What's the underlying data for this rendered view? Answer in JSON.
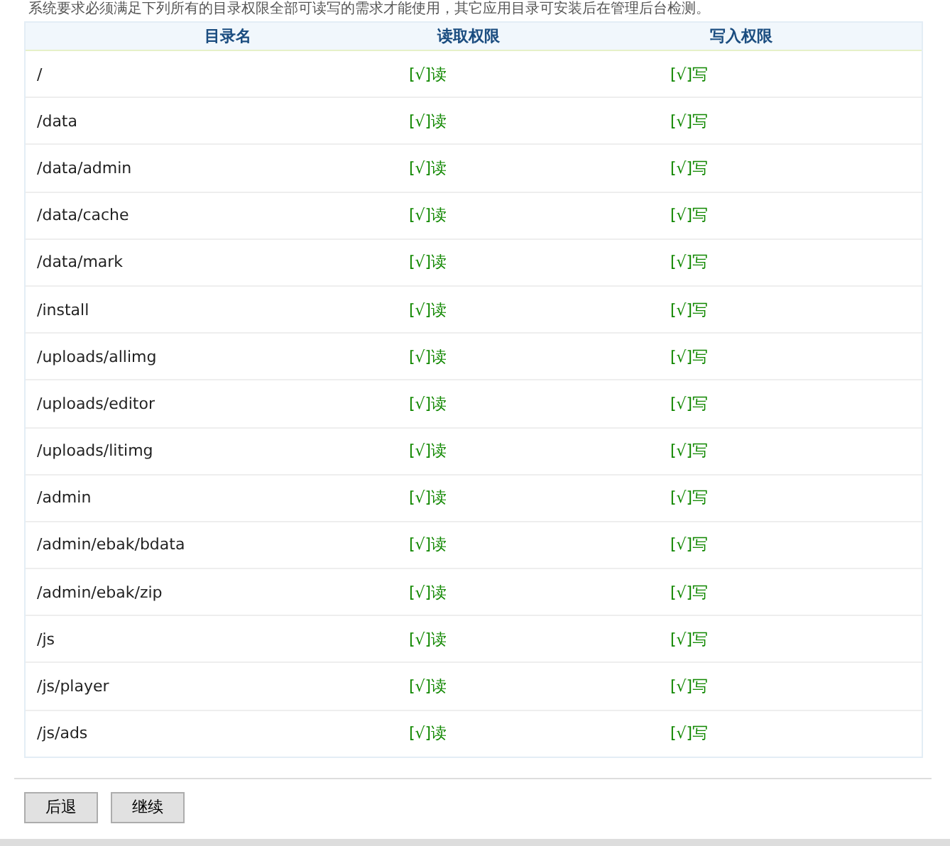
{
  "intro": "系统要求必须满足下列所有的目录权限全部可读写的需求才能使用，其它应用目录可安装后在管理后台检测。",
  "table": {
    "columns": [
      "目录名",
      "读取权限",
      "写入权限"
    ],
    "rows": [
      {
        "dir": "/",
        "read": "[√]读",
        "write": "[√]写"
      },
      {
        "dir": "/data",
        "read": "[√]读",
        "write": "[√]写"
      },
      {
        "dir": "/data/admin",
        "read": "[√]读",
        "write": "[√]写"
      },
      {
        "dir": "/data/cache",
        "read": "[√]读",
        "write": "[√]写"
      },
      {
        "dir": "/data/mark",
        "read": "[√]读",
        "write": "[√]写"
      },
      {
        "dir": "/install",
        "read": "[√]读",
        "write": "[√]写"
      },
      {
        "dir": "/uploads/allimg",
        "read": "[√]读",
        "write": "[√]写"
      },
      {
        "dir": "/uploads/editor",
        "read": "[√]读",
        "write": "[√]写"
      },
      {
        "dir": "/uploads/litimg",
        "read": "[√]读",
        "write": "[√]写"
      },
      {
        "dir": "/admin",
        "read": "[√]读",
        "write": "[√]写"
      },
      {
        "dir": "/admin/ebak/bdata",
        "read": "[√]读",
        "write": "[√]写"
      },
      {
        "dir": "/admin/ebak/zip",
        "read": "[√]读",
        "write": "[√]写"
      },
      {
        "dir": "/js",
        "read": "[√]读",
        "write": "[√]写"
      },
      {
        "dir": "/js/player",
        "read": "[√]读",
        "write": "[√]写"
      },
      {
        "dir": "/js/ads",
        "read": "[√]读",
        "write": "[√]写"
      }
    ]
  },
  "buttons": [
    "后退",
    "继续"
  ]
}
